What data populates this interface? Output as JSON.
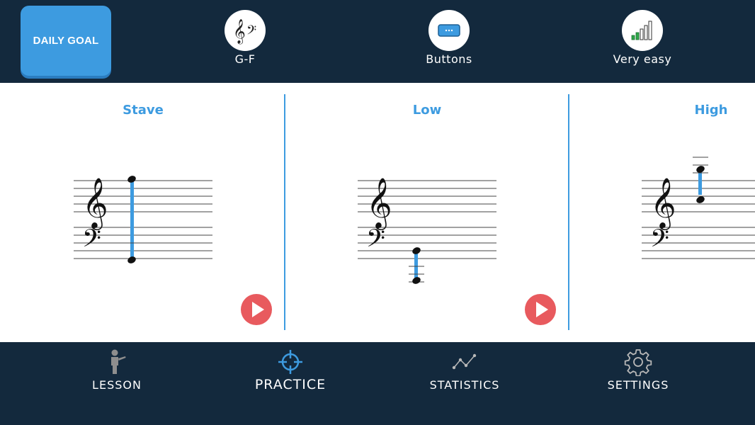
{
  "header": {
    "daily_goal_label": "DAILY GOAL",
    "options": [
      {
        "label": "G-F",
        "icon": "clefs-icon"
      },
      {
        "label": "Buttons",
        "icon": "buttons-icon"
      },
      {
        "label": "Very easy",
        "icon": "difficulty-bars-icon"
      }
    ]
  },
  "panels": [
    {
      "title": "Stave",
      "has_play": true
    },
    {
      "title": "Low",
      "has_play": true
    },
    {
      "title": "High",
      "has_play": false
    }
  ],
  "nav": {
    "items": [
      {
        "label": "LESSON",
        "icon": "teacher-icon",
        "active": false
      },
      {
        "label": "PRACTICE",
        "icon": "crosshair-icon",
        "active": true
      },
      {
        "label": "STATISTICS",
        "icon": "line-chart-icon",
        "active": false
      },
      {
        "label": "SETTINGS",
        "icon": "gear-icon",
        "active": false
      }
    ]
  },
  "colors": {
    "navy": "#13293d",
    "accent_blue": "#3d9be0",
    "play_red": "#e85a5e",
    "bars_green": "#2ea84a"
  }
}
